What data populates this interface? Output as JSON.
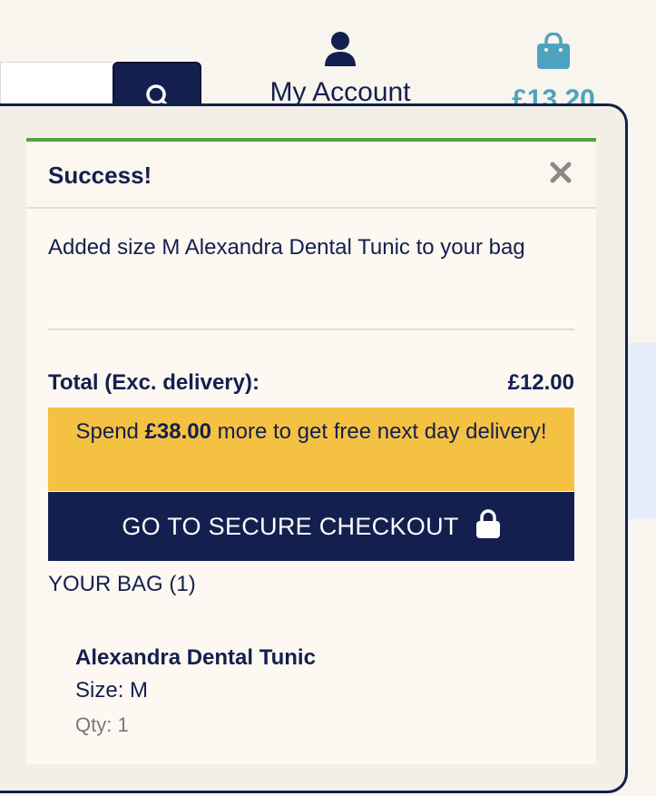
{
  "header": {
    "account_label": "My Account",
    "bag_total": "£13.20",
    "icons": {
      "search": "search-icon",
      "account": "person-icon",
      "bag": "shopping-bag-icon"
    }
  },
  "toast": {
    "title": "Success!",
    "close_icon": "close-icon",
    "message": "Added size M Alexandra Dental Tunic to your bag",
    "total_label": "Total (Exc. delivery):",
    "total_value": "£12.00",
    "delivery": {
      "prefix": "Spend ",
      "amount": "£38.00",
      "suffix": " more to get free next day delivery!"
    },
    "checkout_label": "GO TO SECURE CHECKOUT",
    "checkout_icon": "lock-icon",
    "bag_heading": "YOUR BAG (1)",
    "items": [
      {
        "name": "Alexandra Dental Tunic",
        "size": "Size: M",
        "qty": "Qty: 1"
      }
    ]
  },
  "colors": {
    "navy": "#13204f",
    "success_green": "#54a244",
    "banner_yellow": "#f5c142",
    "bag_teal": "#4da3bd"
  }
}
